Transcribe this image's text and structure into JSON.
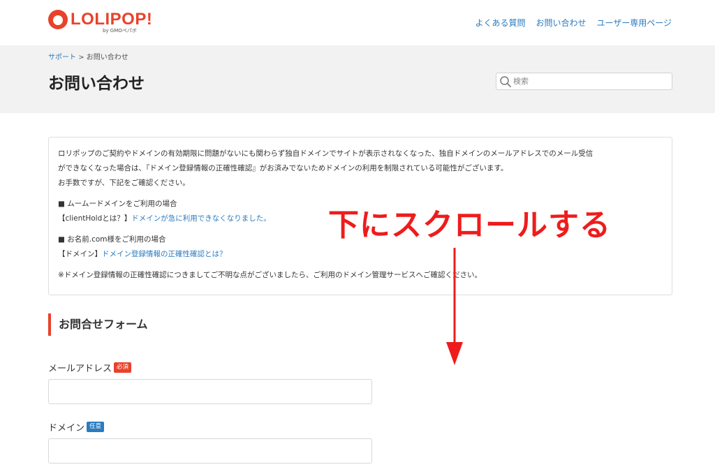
{
  "header": {
    "logo_text": "LOLIPOP!",
    "logo_sub": "by GMOペパボ",
    "nav": [
      "よくある質問",
      "お問い合わせ",
      "ユーザー専用ページ"
    ]
  },
  "breadcrumb": {
    "root": "サポート",
    "separator": ">",
    "current": "お問い合わせ"
  },
  "page_title": "お問い合わせ",
  "search": {
    "placeholder": "検索",
    "value": ""
  },
  "notice": {
    "intro_line1": "ロリポップのご契約やドメインの有効期限に問題がないにも関わらず独自ドメインでサイトが表示されなくなった、独自ドメインのメールアドレスでのメール受信",
    "intro_line2": "ができなくなった場合は、『ドメイン登録情報の正確性確認』がお済みでないためドメインの利用を制限されている可能性がございます。",
    "intro_line3": "お手数ですが、下記をご確認ください。",
    "muumuu_heading": "■  ムームードメインをご利用の場合",
    "muumuu_prefix": "【clientHoldとは？】",
    "muumuu_link": "ドメインが急に利用できなくなりました。",
    "onamae_heading": "■  お名前.com様をご利用の場合",
    "onamae_prefix": "【ドメイン】",
    "onamae_link": "ドメイン登録情報の正確性確認とは？",
    "footer": "※ドメイン登録情報の正確性確認につきましてご不明な点がございましたら、ご利用のドメイン管理サービスへご確認ください。"
  },
  "form": {
    "section_title": "お問合せフォーム",
    "email": {
      "label": "メールアドレス",
      "badge": "必須",
      "value": ""
    },
    "domain": {
      "label": "ドメイン",
      "badge": "任意",
      "value": ""
    }
  },
  "annotation": {
    "text": "下にスクロールする",
    "color": "#ee1c1c"
  },
  "colors": {
    "brand": "#e8422c",
    "link": "#2b7bbf",
    "hero_bg": "#f2f2f2"
  },
  "icons": [
    "logo-mark-icon",
    "search-icon",
    "down-arrow-icon"
  ]
}
